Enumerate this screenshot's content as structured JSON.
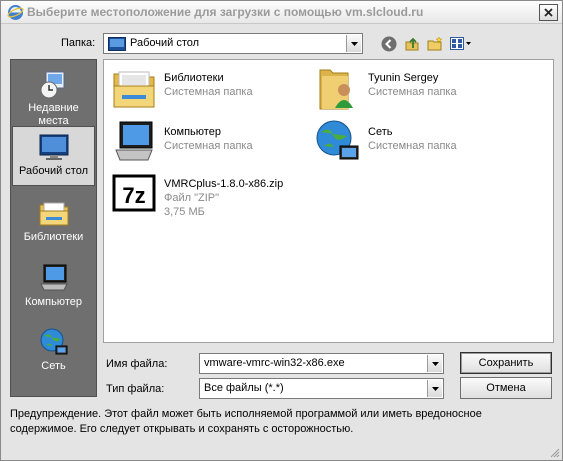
{
  "window": {
    "title": "Выберите местоположение для загрузки с помощью vm.slcloud.ru"
  },
  "location": {
    "label": "Папка:",
    "value": "Рабочий стол"
  },
  "toolbar": {
    "icons": [
      "back-icon",
      "up-folder-icon",
      "new-folder-icon",
      "view-menu-icon"
    ]
  },
  "places": [
    {
      "label": "Недавние места",
      "icon": "recent-places-icon",
      "selected": false
    },
    {
      "label": "Рабочий стол",
      "icon": "desktop-icon",
      "selected": true
    },
    {
      "label": "Библиотеки",
      "icon": "libraries-icon",
      "selected": false
    },
    {
      "label": "Компьютер",
      "icon": "computer-icon",
      "selected": false
    },
    {
      "label": "Сеть",
      "icon": "network-icon",
      "selected": false
    }
  ],
  "files": [
    {
      "name": "Библиотеки",
      "type": "Системная папка",
      "icon": "libraries-icon"
    },
    {
      "name": "Tyunin Sergey",
      "type": "Системная папка",
      "icon": "user-folder-icon"
    },
    {
      "name": "Компьютер",
      "type": "Системная папка",
      "icon": "computer-icon"
    },
    {
      "name": "Сеть",
      "type": "Системная папка",
      "icon": "network-icon"
    },
    {
      "name": "VMRCplus-1.8.0-x86.zip",
      "type": "Файл \"ZIP\"",
      "size": "3,75 МБ",
      "icon": "7zip-archive-icon"
    }
  ],
  "form": {
    "filename_label": "Имя файла:",
    "filename_value": "vmware-vmrc-win32-x86.exe",
    "filetype_label": "Тип файла:",
    "filetype_value": "Все файлы (*.*)",
    "save_label": "Сохранить",
    "cancel_label": "Отмена"
  },
  "warning": "Предупреждение. Этот файл может быть исполняемой программой или иметь вредоносное содержимое. Его следует открывать и сохранять с осторожностью.",
  "archive_icon_text": "7z"
}
